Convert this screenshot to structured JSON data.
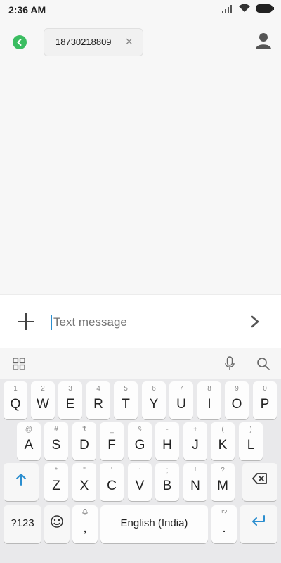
{
  "status_bar": {
    "time": "2:36 AM"
  },
  "header": {
    "recipient": "18730218809"
  },
  "composer": {
    "placeholder": "Text message"
  },
  "keyboard": {
    "row1": [
      {
        "hint": "1",
        "key": "Q"
      },
      {
        "hint": "2",
        "key": "W"
      },
      {
        "hint": "3",
        "key": "E"
      },
      {
        "hint": "4",
        "key": "R"
      },
      {
        "hint": "5",
        "key": "T"
      },
      {
        "hint": "6",
        "key": "Y"
      },
      {
        "hint": "7",
        "key": "U"
      },
      {
        "hint": "8",
        "key": "I"
      },
      {
        "hint": "9",
        "key": "O"
      },
      {
        "hint": "0",
        "key": "P"
      }
    ],
    "row2": [
      {
        "hint": "@",
        "key": "A"
      },
      {
        "hint": "#",
        "key": "S"
      },
      {
        "hint": "₹",
        "key": "D"
      },
      {
        "hint": "_",
        "key": "F"
      },
      {
        "hint": "&",
        "key": "G"
      },
      {
        "hint": "-",
        "key": "H"
      },
      {
        "hint": "+",
        "key": "J"
      },
      {
        "hint": "(",
        "key": "K"
      },
      {
        "hint": ")",
        "key": "L"
      }
    ],
    "row3": [
      {
        "hint": "*",
        "key": "Z"
      },
      {
        "hint": "\"",
        "key": "X"
      },
      {
        "hint": "'",
        "key": "C"
      },
      {
        "hint": ":",
        "key": "V"
      },
      {
        "hint": ";",
        "key": "B"
      },
      {
        "hint": "!",
        "key": "N"
      },
      {
        "hint": "?",
        "key": "M"
      }
    ],
    "symbols_label": "?123",
    "comma_key": ",",
    "space_label": "English (India)",
    "period_key": ".",
    "period_hint": "!?"
  },
  "colors": {
    "accent": "#2b8ecf",
    "back_green": "#3bbd61"
  }
}
